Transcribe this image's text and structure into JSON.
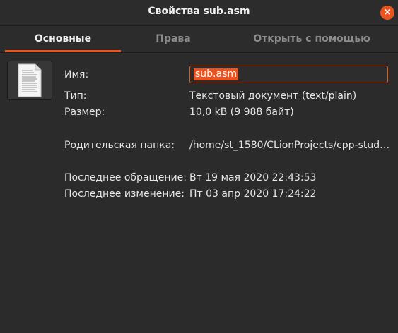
{
  "window": {
    "title": "Свойства sub.asm",
    "close_glyph": "×"
  },
  "tabs": [
    {
      "label": "Основные",
      "active": true
    },
    {
      "label": "Права",
      "active": false
    },
    {
      "label": "Открыть с помощью",
      "active": false
    }
  ],
  "icon": "text-document-icon",
  "fields": {
    "name_label": "Имя:",
    "name_value": "sub.asm",
    "type_label": "Тип:",
    "type_value": "Текстовый документ (text/plain)",
    "size_label": "Размер:",
    "size_value": "10,0 kB (9 988 байт)",
    "parent_label": "Родительская папка:",
    "parent_value": "/home/st_1580/CLionProjects/cpp-stud…",
    "accessed_label": "Последнее обращение:",
    "accessed_value": "Вт 19 мая 2020 22:43:53",
    "modified_label": "Последнее изменение:",
    "modified_value": "Пт 03 апр 2020 17:24:22"
  },
  "colors": {
    "accent": "#e95420",
    "background": "#2b2b2b"
  }
}
